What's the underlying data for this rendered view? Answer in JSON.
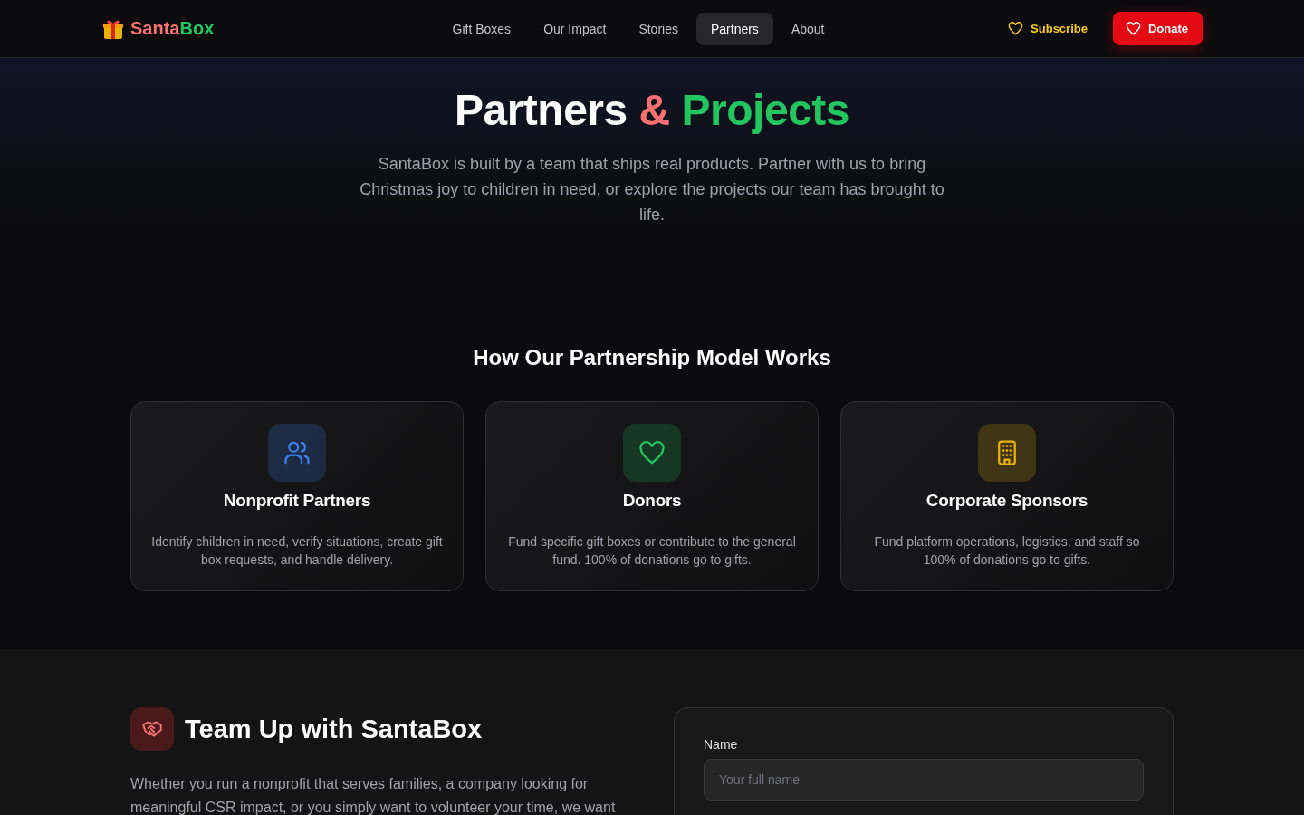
{
  "brand": {
    "part_1": "Santa",
    "part_2": "Box"
  },
  "nav": [
    {
      "label": "Gift Boxes",
      "selected": false
    },
    {
      "label": "Our Impact",
      "selected": false
    },
    {
      "label": "Stories",
      "selected": false
    },
    {
      "label": "Partners",
      "selected": true
    },
    {
      "label": "About",
      "selected": false
    }
  ],
  "actions": {
    "subscribe": "Subscribe",
    "donate": "Donate"
  },
  "hero": {
    "title_1": "Partners",
    "title_amp": "&",
    "title_2": "Projects",
    "text": "SantaBox is built by a team that ships real products. Partner with us to bring Christmas joy to children in need, or explore the projects our team has brought to life."
  },
  "model": {
    "heading": "How Our Partnership Model Works",
    "cards": [
      {
        "kind": "people",
        "color": "#3b82f6",
        "title": "Nonprofit Partners",
        "text": "Identify children in need, verify situations, create gift box requests, and handle delivery."
      },
      {
        "kind": "heart",
        "color": "#22c55e",
        "title": "Donors",
        "text": "Fund specific gift boxes or contribute to the general fund. 100% of donations go to gifts."
      },
      {
        "kind": "building",
        "color": "#eab308",
        "title": "Corporate Sponsors",
        "text": "Fund platform operations, logistics, and staff so 100% of donations go to gifts."
      }
    ]
  },
  "team_up": {
    "heading": "Team Up with SantaBox",
    "text": "Whether you run a nonprofit that serves families, a company looking for meaningful CSR impact, or you simply want to volunteer your time, we want"
  },
  "form": {
    "name_label": "Name",
    "name_placeholder": "Your full name"
  }
}
